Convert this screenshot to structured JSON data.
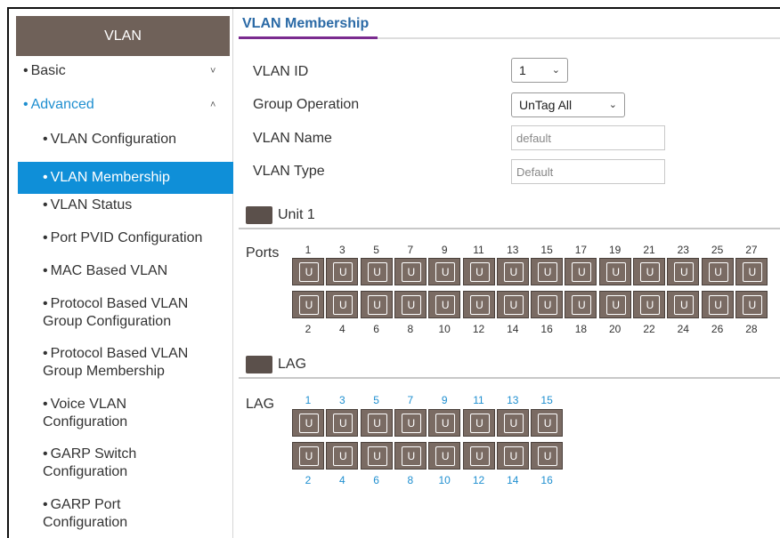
{
  "sidebar": {
    "header": "VLAN",
    "items": [
      {
        "label": "Basic",
        "type": "top"
      },
      {
        "label": "Advanced",
        "type": "top",
        "expanded": true
      },
      {
        "label": "VLAN Configuration",
        "type": "sub"
      },
      {
        "label": "VLAN Membership",
        "type": "sub",
        "selected": true
      },
      {
        "label": "VLAN Status",
        "type": "sub"
      },
      {
        "label": "Port PVID Configuration",
        "type": "sub"
      },
      {
        "label": "MAC Based VLAN",
        "type": "sub"
      },
      {
        "label": "Protocol Based VLAN\nGroup Configuration",
        "type": "sub"
      },
      {
        "label": "Protocol Based VLAN\nGroup Membership",
        "type": "sub"
      },
      {
        "label": "Voice VLAN\nConfiguration",
        "type": "sub"
      },
      {
        "label": "GARP Switch\nConfiguration",
        "type": "sub"
      },
      {
        "label": "GARP Port\nConfiguration",
        "type": "sub"
      }
    ]
  },
  "main": {
    "title": "VLAN Membership",
    "fields": {
      "vlan_id_label": "VLAN ID",
      "vlan_id_value": "1",
      "group_op_label": "Group Operation",
      "group_op_value": "UnTag All",
      "vlan_name_label": "VLAN Name",
      "vlan_name_value": "default",
      "vlan_type_label": "VLAN Type",
      "vlan_type_value": "Default"
    },
    "unit_section": "Unit 1",
    "ports_label": "Ports",
    "port_state": "U",
    "ports_top": [
      "1",
      "3",
      "5",
      "7",
      "9",
      "11",
      "13",
      "15",
      "17",
      "19",
      "21",
      "23",
      "25",
      "27"
    ],
    "ports_bottom": [
      "2",
      "4",
      "6",
      "8",
      "10",
      "12",
      "14",
      "16",
      "18",
      "20",
      "22",
      "24",
      "26",
      "28"
    ],
    "lag_section": "LAG",
    "lag_label": "LAG",
    "lag_top": [
      "1",
      "3",
      "5",
      "7",
      "9",
      "11",
      "13",
      "15"
    ],
    "lag_bottom": [
      "2",
      "4",
      "6",
      "8",
      "10",
      "12",
      "14",
      "16"
    ]
  },
  "colors": {
    "accent_blue": "#0f8fd8",
    "link_blue": "#1f8fd0",
    "header_brown": "#6f6159",
    "port_brown": "#7a6b63",
    "tab_underline": "#7a2b8f"
  }
}
